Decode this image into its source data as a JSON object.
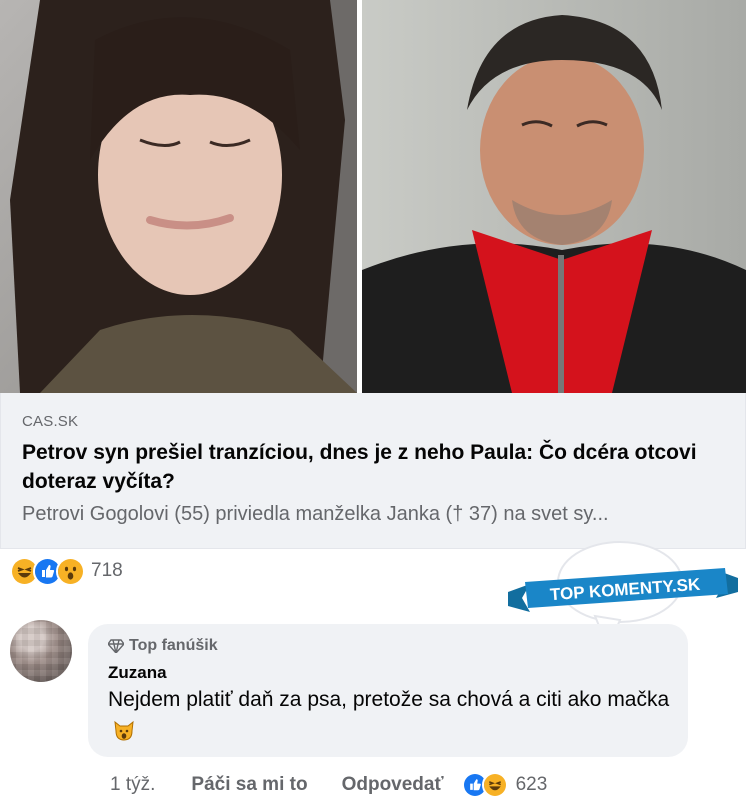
{
  "link": {
    "domain": "CAS.SK",
    "title": "Petrov syn prešiel tranzíciou, dnes je z neho Paula: Čo dcéra otcovi doteraz vyčíta?",
    "description": "Petrovi Gogolovi (55) priviedla manželka Janka († 37) na svet sy..."
  },
  "post_reactions": {
    "icons": [
      "haha-icon",
      "like-icon",
      "wow-icon"
    ],
    "count": "718"
  },
  "badge": {
    "text": "TOP KOMENTY.SK"
  },
  "comment": {
    "badge_label": "Top fanúšik",
    "author": "Zuzana",
    "text": "Nejdem platiť daň za psa, pretože sa chová a citi ako mačka",
    "emoji": "cat-face-icon"
  },
  "comment_actions": {
    "time": "1 týž.",
    "like_label": "Páči sa mi to",
    "reply_label": "Odpovedať",
    "reaction_icons": [
      "like-icon",
      "haha-icon"
    ],
    "reaction_count": "623"
  },
  "colors": {
    "link_card_bg": "#f0f2f5",
    "meta_text": "#65676b",
    "like_blue": "#1877f2",
    "haha_yellow": "#f7b125",
    "badge_blue": "#1a86c8"
  }
}
